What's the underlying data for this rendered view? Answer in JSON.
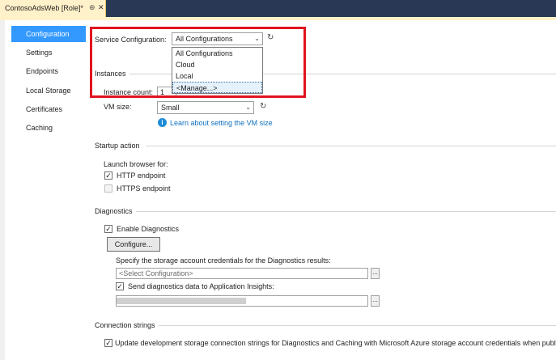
{
  "tab": {
    "title": "ContosoAdsWeb [Role]*",
    "pin_glyph": "⊕",
    "close_glyph": "✕"
  },
  "sidebar": {
    "items": [
      {
        "label": "Configuration",
        "active": true
      },
      {
        "label": "Settings",
        "active": false
      },
      {
        "label": "Endpoints",
        "active": false
      },
      {
        "label": "Local Storage",
        "active": false
      },
      {
        "label": "Certificates",
        "active": false
      },
      {
        "label": "Caching",
        "active": false
      }
    ]
  },
  "service_config": {
    "label": "Service Configuration:",
    "selected": "All Configurations",
    "options": [
      "All Configurations",
      "Cloud",
      "Local",
      "<Manage...>"
    ]
  },
  "instances": {
    "section_label": "Instances",
    "count_label": "Instance count:",
    "count_value": "1",
    "vm_size_label": "VM size:",
    "vm_size_value": "Small",
    "learn_link": "Learn about setting the VM size"
  },
  "startup": {
    "section_label": "Startup action",
    "launch_label": "Launch browser for:",
    "http_label": "HTTP endpoint",
    "http_checked": true,
    "https_label": "HTTPS endpoint",
    "https_checked": false
  },
  "diagnostics": {
    "section_label": "Diagnostics",
    "enable_label": "Enable Diagnostics",
    "enable_checked": true,
    "configure_button": "Configure...",
    "storage_label": "Specify the storage account credentials for the Diagnostics results:",
    "storage_placeholder": "<Select Configuration>",
    "browse_label": "...",
    "insights_label": "Send diagnostics data to Application Insights:",
    "insights_checked": true
  },
  "connection": {
    "section_label": "Connection strings",
    "update_label": "Update development storage connection strings for Diagnostics and Caching with Microsoft Azure storage account credentials when publ",
    "update_checked": true
  },
  "icons": {
    "chevron": "⌄",
    "check": "✓",
    "info": "i",
    "refresh": "↻"
  },
  "colors": {
    "accent": "#3399ff",
    "highlight": "#e0141e",
    "link": "#0e70c0",
    "tabstrip": "#293955",
    "doc_tab": "#fff1c9"
  }
}
